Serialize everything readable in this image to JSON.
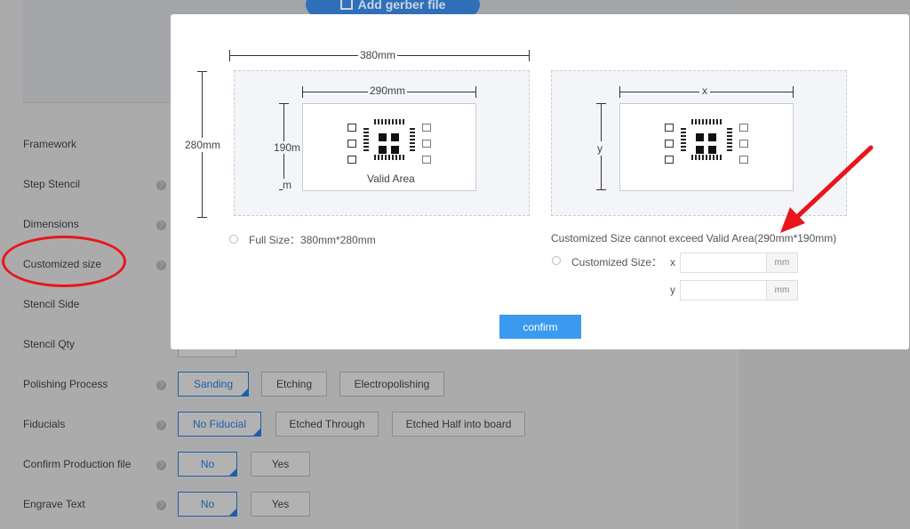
{
  "page": {
    "upload_button": "Add gerber file",
    "rows": [
      {
        "label": "Framework"
      },
      {
        "label": "Step Stencil"
      },
      {
        "label": "Dimensions"
      },
      {
        "label": "Customized size"
      },
      {
        "label": "Stencil Side"
      },
      {
        "label": "Stencil Qty"
      },
      {
        "label": "Polishing Process",
        "options": [
          "Sanding",
          "Etching",
          "Electropolishing"
        ],
        "selected": "Sanding"
      },
      {
        "label": "Fiducials",
        "options": [
          "No Fiducial",
          "Etched Through",
          "Etched Half into board"
        ],
        "selected": "No Fiducial"
      },
      {
        "label": "Confirm Production file",
        "options": [
          "No",
          "Yes"
        ],
        "selected": "No"
      },
      {
        "label": "Engrave Text",
        "options": [
          "No",
          "Yes"
        ],
        "selected": "No"
      }
    ],
    "help_icon": "?",
    "annotation_color": "#e8151a"
  },
  "modal": {
    "full_size": {
      "outer_width": "380mm",
      "outer_height": "280mm",
      "inner_width": "290mm",
      "inner_height_line1": "190m",
      "inner_height_line2": "m",
      "valid_area": "Valid Area",
      "option_label": "Full Size：380mm*280mm"
    },
    "custom_size": {
      "x_label": "x",
      "y_label": "y",
      "warning": "Customized Size cannot exceed Valid Area(290mm*190mm)",
      "option_label": "Customized Size：",
      "field_x_label": "x",
      "field_y_label": "y",
      "field_x_value": "",
      "field_y_value": "",
      "unit": "mm"
    },
    "confirm_label": "confirm",
    "accent_color": "#3a9af0"
  }
}
